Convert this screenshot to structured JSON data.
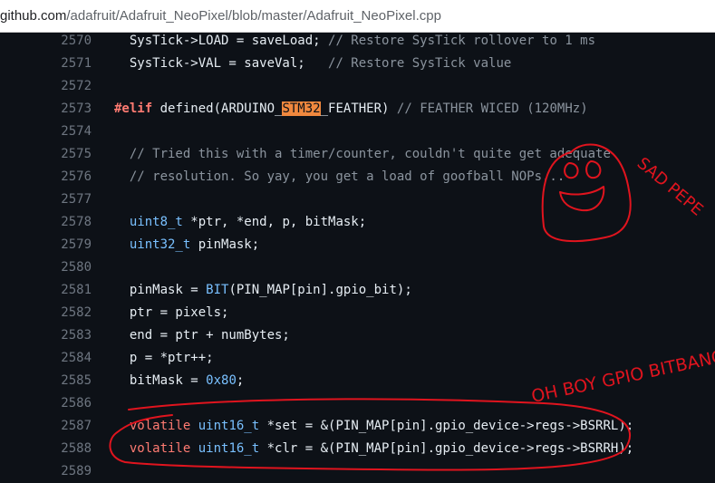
{
  "browser": {
    "url_host": "github.com",
    "url_path": "/adafruit/Adafruit_NeoPixel/blob/master/Adafruit_NeoPixel.cpp"
  },
  "code": {
    "lines": [
      {
        "n": "2570",
        "parts": [
          {
            "t": "  SysTick->LOAD = saveLoad; ",
            "c": ""
          },
          {
            "t": "// Restore SysTick rollover to 1 ms",
            "c": "cm"
          }
        ]
      },
      {
        "n": "2571",
        "parts": [
          {
            "t": "  SysTick->VAL = saveVal;   ",
            "c": ""
          },
          {
            "t": "// Restore SysTick value",
            "c": "cm"
          }
        ]
      },
      {
        "n": "2572",
        "parts": []
      },
      {
        "n": "2573",
        "parts": [
          {
            "t": "#elif",
            "c": "pp"
          },
          {
            "t": " defined(ARDUINO_",
            "c": ""
          },
          {
            "t": "STM32",
            "c": "hl"
          },
          {
            "t": "_FEATHER) ",
            "c": ""
          },
          {
            "t": "// FEATHER WICED (120MHz)",
            "c": "cm"
          }
        ]
      },
      {
        "n": "2574",
        "parts": []
      },
      {
        "n": "2575",
        "parts": [
          {
            "t": "  // Tried this with a timer/counter, couldn't quite get adequate",
            "c": "cm"
          }
        ]
      },
      {
        "n": "2576",
        "parts": [
          {
            "t": "  // resolution. So yay, you get a load of goofball NOPs...",
            "c": "cm"
          }
        ]
      },
      {
        "n": "2577",
        "parts": []
      },
      {
        "n": "2578",
        "parts": [
          {
            "t": "  ",
            "c": ""
          },
          {
            "t": "uint8_t",
            "c": "ty"
          },
          {
            "t": " *ptr, *end, p, bitMask;",
            "c": ""
          }
        ]
      },
      {
        "n": "2579",
        "parts": [
          {
            "t": "  ",
            "c": ""
          },
          {
            "t": "uint32_t",
            "c": "ty"
          },
          {
            "t": " pinMask;",
            "c": ""
          }
        ]
      },
      {
        "n": "2580",
        "parts": []
      },
      {
        "n": "2581",
        "parts": [
          {
            "t": "  pinMask = ",
            "c": ""
          },
          {
            "t": "BIT",
            "c": "bi"
          },
          {
            "t": "(PIN_MAP[pin].gpio_bit);",
            "c": ""
          }
        ]
      },
      {
        "n": "2582",
        "parts": [
          {
            "t": "  ptr = pixels;",
            "c": ""
          }
        ]
      },
      {
        "n": "2583",
        "parts": [
          {
            "t": "  end = ptr + numBytes;",
            "c": ""
          }
        ]
      },
      {
        "n": "2584",
        "parts": [
          {
            "t": "  p = *ptr++;",
            "c": ""
          }
        ]
      },
      {
        "n": "2585",
        "parts": [
          {
            "t": "  bitMask = ",
            "c": ""
          },
          {
            "t": "0x80",
            "c": "nu"
          },
          {
            "t": ";",
            "c": ""
          }
        ]
      },
      {
        "n": "2586",
        "parts": []
      },
      {
        "n": "2587",
        "parts": [
          {
            "t": "  ",
            "c": ""
          },
          {
            "t": "volatile",
            "c": "kw"
          },
          {
            "t": " ",
            "c": ""
          },
          {
            "t": "uint16_t",
            "c": "ty"
          },
          {
            "t": " *set = &(PIN_MAP[pin].gpio_device->regs->BSRRL);",
            "c": ""
          }
        ]
      },
      {
        "n": "2588",
        "parts": [
          {
            "t": "  ",
            "c": ""
          },
          {
            "t": "volatile",
            "c": "kw"
          },
          {
            "t": " ",
            "c": ""
          },
          {
            "t": "uint16_t",
            "c": "ty"
          },
          {
            "t": " *clr = &(PIN_MAP[pin].gpio_device->regs->BSRRH);",
            "c": ""
          }
        ]
      },
      {
        "n": "2589",
        "parts": []
      }
    ]
  },
  "annotations": {
    "color": "#e0141e",
    "sad_text": "SAD PEPE",
    "gpio_text": "OH BOY GPIO BITBANG"
  }
}
